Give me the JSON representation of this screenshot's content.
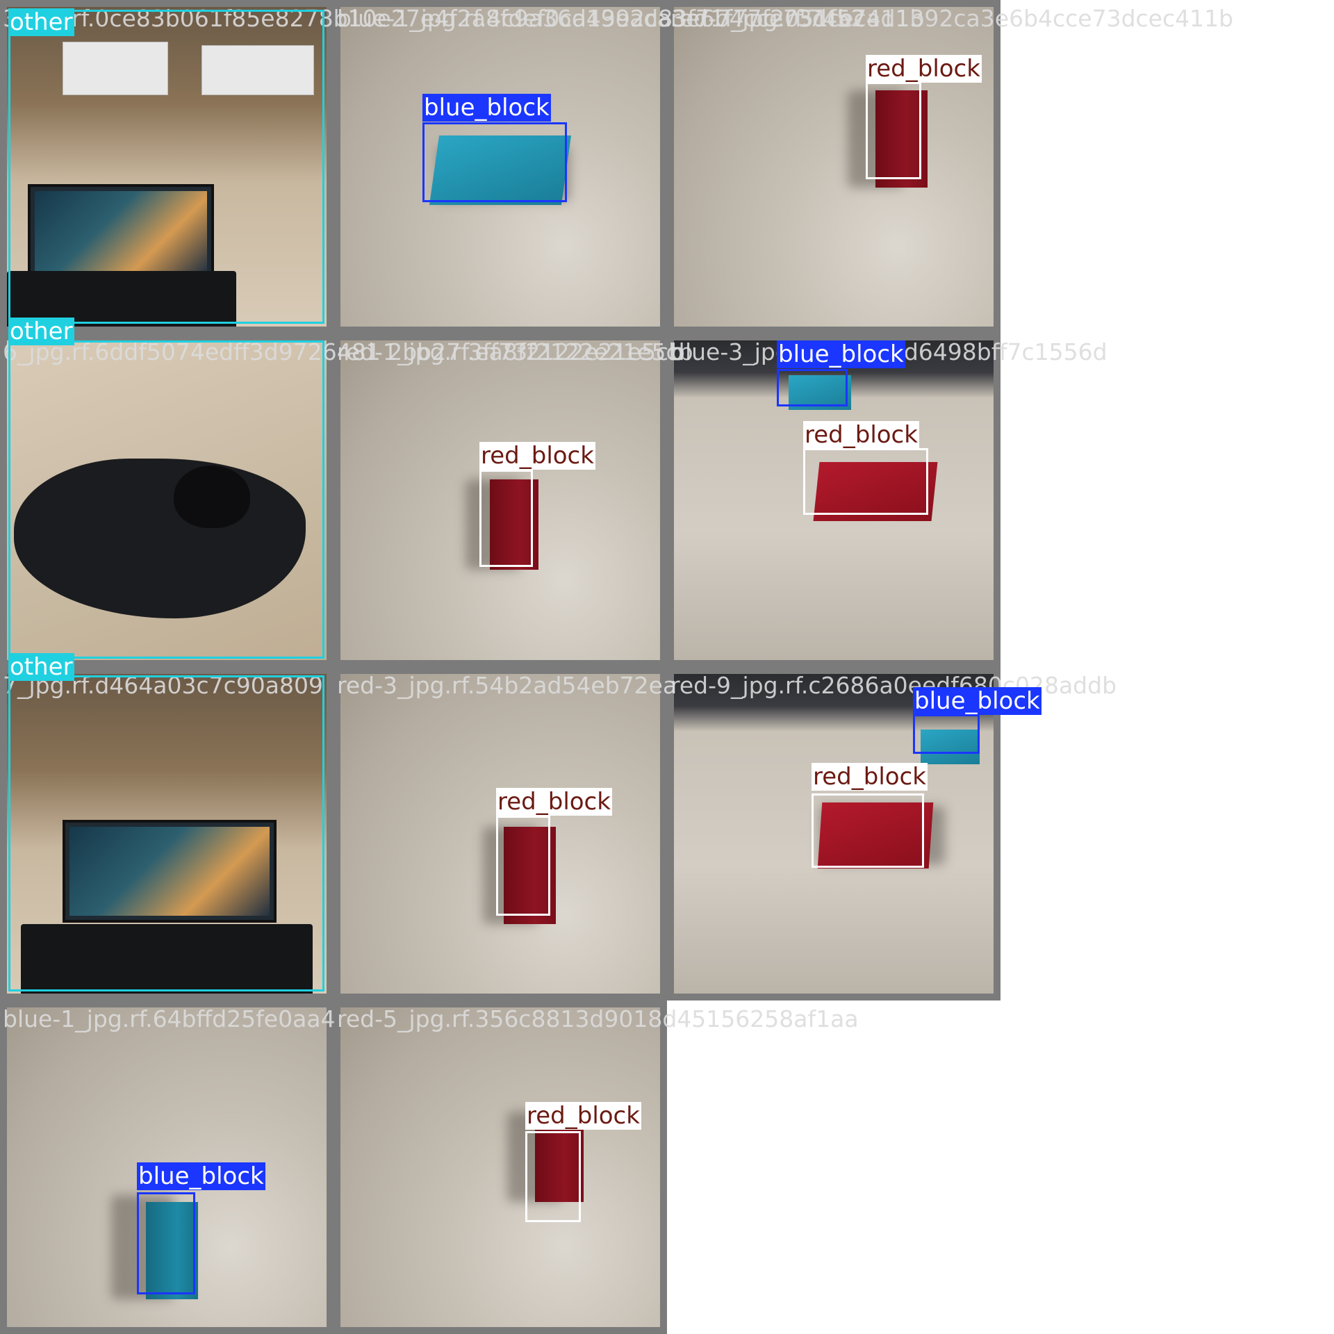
{
  "tiles": [
    {
      "filename": "3_jpg.rf.0ce83b061f85e8278b10e27e4f2a8fdef0ca49ead83f71f77f2051f52",
      "detections": [
        {
          "label": "other"
        }
      ]
    },
    {
      "filename": "blue-1_jpg.rf.4c9a36d1392ca3e6b4cce73dcec411b",
      "detections": [
        {
          "label": "blue_block"
        }
      ]
    },
    {
      "filename": "red-7_jpg.rf.74b7ad1392ca3e6b4cce73dcec411b",
      "detections": [
        {
          "label": "red_block"
        }
      ]
    },
    {
      "filename": "6_jpg.rf.6ddf5074edff3d9726481 2bb27 3ff73f2122e21e5cb",
      "detections": [
        {
          "label": "other"
        }
      ]
    },
    {
      "filename": "red-1_jpg.rf.ea8f2122e21e5cb",
      "detections": [
        {
          "label": "red_block"
        }
      ]
    },
    {
      "filename": "blue-3_jpg.rf.c6243cd6498bff7c1556d",
      "detections": [
        {
          "label": "blue_block"
        },
        {
          "label": "red_block"
        }
      ]
    },
    {
      "filename": "7_jpg.rf.d464a03c7c90a809",
      "detections": [
        {
          "label": "other"
        }
      ]
    },
    {
      "filename": "red-3_jpg.rf.54b2ad54eb72ea",
      "detections": [
        {
          "label": "red_block"
        }
      ]
    },
    {
      "filename": "red-9_jpg.rf.c2686a0eedf680c028addb",
      "detections": [
        {
          "label": "blue_block"
        },
        {
          "label": "red_block"
        }
      ]
    },
    {
      "filename": "blue-1_jpg.rf.64bffd25fe0aa4",
      "detections": [
        {
          "label": "blue_block"
        }
      ]
    },
    {
      "filename": "red-5_jpg.rf.356c8813d9018d45156258af1aa",
      "detections": [
        {
          "label": "red_block"
        }
      ]
    }
  ],
  "colors": {
    "blue_block": "#1a36ff",
    "red_block": "#ffffff",
    "other": "#1fd0e0"
  }
}
